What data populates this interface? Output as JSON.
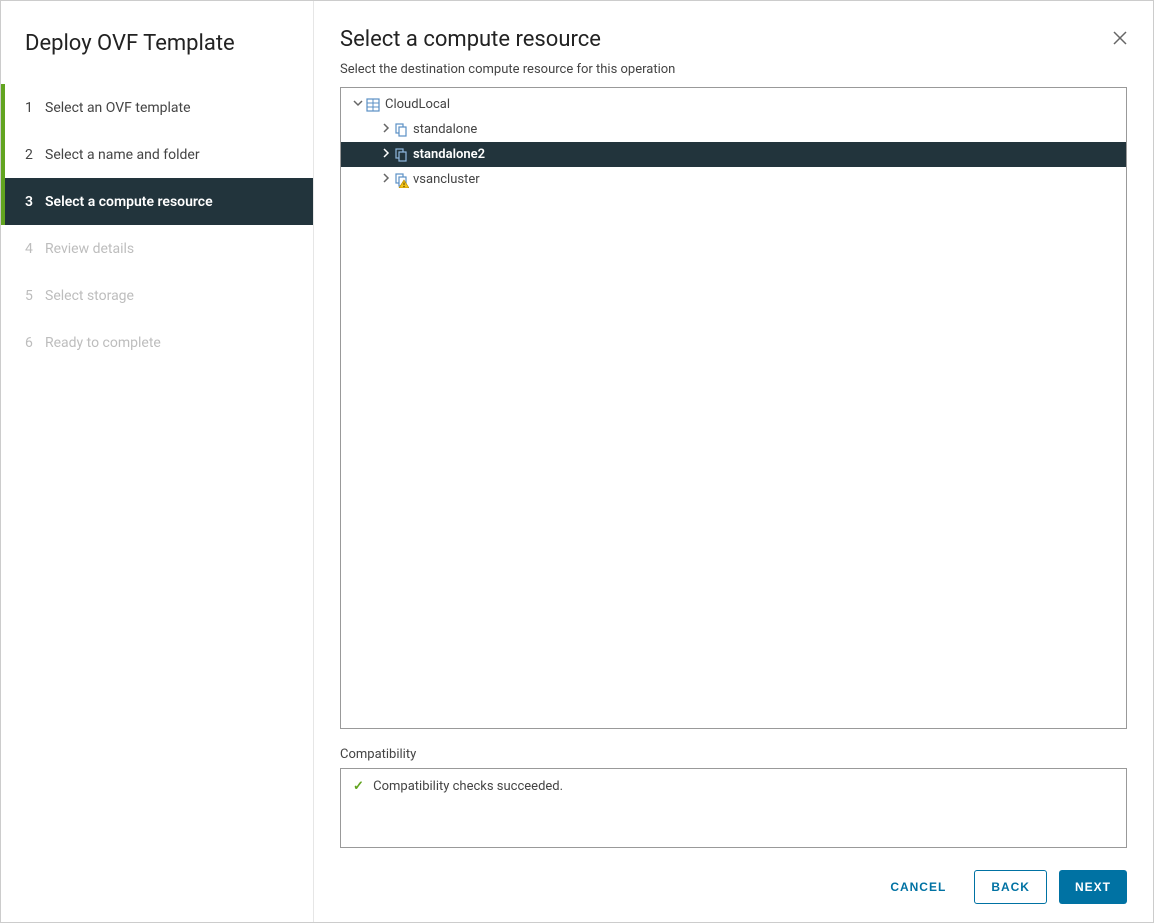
{
  "sidebar": {
    "title": "Deploy OVF Template",
    "steps": [
      {
        "num": "1",
        "label": "Select an OVF template",
        "state": "completed"
      },
      {
        "num": "2",
        "label": "Select a name and folder",
        "state": "completed"
      },
      {
        "num": "3",
        "label": "Select a compute resource",
        "state": "active"
      },
      {
        "num": "4",
        "label": "Review details",
        "state": "disabled"
      },
      {
        "num": "5",
        "label": "Select storage",
        "state": "disabled"
      },
      {
        "num": "6",
        "label": "Ready to complete",
        "state": "disabled"
      }
    ]
  },
  "main": {
    "title": "Select a compute resource",
    "subtitle": "Select the destination compute resource for this operation",
    "tree": {
      "root": "CloudLocal",
      "children": [
        {
          "name": "standalone",
          "type": "cluster",
          "selected": false
        },
        {
          "name": "standalone2",
          "type": "cluster",
          "selected": true
        },
        {
          "name": "vsancluster",
          "type": "cluster-warning",
          "selected": false
        }
      ]
    },
    "compat_label": "Compatibility",
    "compat_msg": "Compatibility checks succeeded."
  },
  "footer": {
    "cancel": "CANCEL",
    "back": "BACK",
    "next": "NEXT"
  }
}
